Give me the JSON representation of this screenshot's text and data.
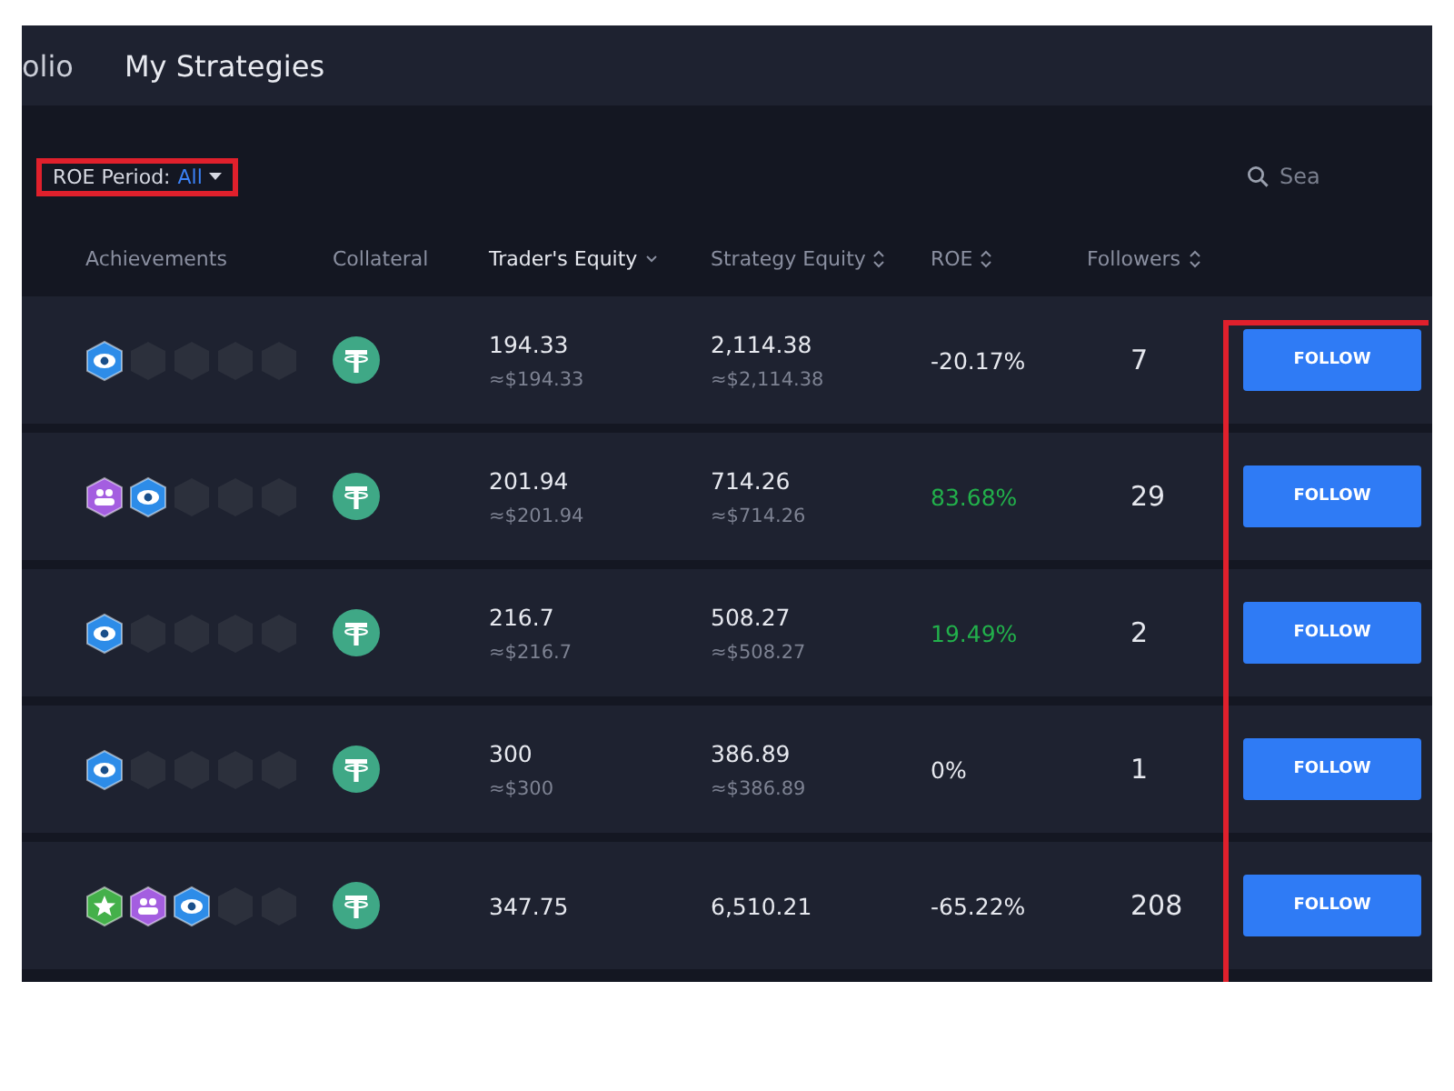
{
  "nav": {
    "tabs": [
      {
        "label": "olio",
        "selected": false
      },
      {
        "label": "My Strategies",
        "selected": true
      }
    ]
  },
  "filter": {
    "label": "ROE Period:",
    "value": "All",
    "highlighted": true
  },
  "search": {
    "placeholder": "Sea"
  },
  "table": {
    "columns": [
      {
        "label": "Achievements",
        "sortable": false,
        "sorted": false
      },
      {
        "label": "Collateral",
        "sortable": false,
        "sorted": false
      },
      {
        "label": "Trader's Equity",
        "sortable": true,
        "sorted": true
      },
      {
        "label": "Strategy Equity",
        "sortable": true,
        "sorted": false
      },
      {
        "label": "ROE",
        "sortable": true,
        "sorted": false
      },
      {
        "label": "Followers",
        "sortable": true,
        "sorted": false
      }
    ],
    "actions_highlighted": true,
    "rows": [
      {
        "badges": [
          {
            "kind": "eye"
          },
          {
            "kind": "empty"
          },
          {
            "kind": "empty"
          },
          {
            "kind": "empty"
          },
          {
            "kind": "empty"
          }
        ],
        "traders_equity": "194.33",
        "traders_equity_usd": "≈$194.33",
        "strategy_equity": "2,114.38",
        "strategy_equity_usd": "≈$2,114.38",
        "roe": "-20.17%",
        "roe_positive": false,
        "followers": "7",
        "action": "FOLLOW"
      },
      {
        "badges": [
          {
            "kind": "people"
          },
          {
            "kind": "eye"
          },
          {
            "kind": "empty"
          },
          {
            "kind": "empty"
          },
          {
            "kind": "empty"
          }
        ],
        "traders_equity": "201.94",
        "traders_equity_usd": "≈$201.94",
        "strategy_equity": "714.26",
        "strategy_equity_usd": "≈$714.26",
        "roe": "83.68%",
        "roe_positive": true,
        "followers": "29",
        "action": "FOLLOW"
      },
      {
        "badges": [
          {
            "kind": "eye"
          },
          {
            "kind": "empty"
          },
          {
            "kind": "empty"
          },
          {
            "kind": "empty"
          },
          {
            "kind": "empty"
          }
        ],
        "traders_equity": "216.7",
        "traders_equity_usd": "≈$216.7",
        "strategy_equity": "508.27",
        "strategy_equity_usd": "≈$508.27",
        "roe": "19.49%",
        "roe_positive": true,
        "followers": "2",
        "action": "FOLLOW"
      },
      {
        "badges": [
          {
            "kind": "eye"
          },
          {
            "kind": "empty"
          },
          {
            "kind": "empty"
          },
          {
            "kind": "empty"
          },
          {
            "kind": "empty"
          }
        ],
        "traders_equity": "300",
        "traders_equity_usd": "≈$300",
        "strategy_equity": "386.89",
        "strategy_equity_usd": "≈$386.89",
        "roe": "0%",
        "roe_positive": false,
        "followers": "1",
        "action": "FOLLOW"
      },
      {
        "badges": [
          {
            "kind": "star"
          },
          {
            "kind": "people"
          },
          {
            "kind": "eye"
          },
          {
            "kind": "empty"
          },
          {
            "kind": "empty"
          }
        ],
        "traders_equity": "347.75",
        "strategy_equity": "6,510.21",
        "roe": "-65.22%",
        "roe_positive": false,
        "followers": "208",
        "action": "FOLLOW"
      }
    ]
  }
}
